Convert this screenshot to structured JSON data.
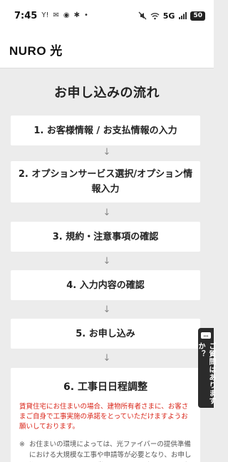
{
  "status_bar": {
    "time": "7:45",
    "left_glyphs": [
      "Y!",
      "✉",
      "◉",
      "✱",
      "•"
    ],
    "network": "5G",
    "battery": "50"
  },
  "header": {
    "logo": "NURO 光"
  },
  "page": {
    "title": "お申し込みの流れ",
    "arrow": "↓",
    "steps": [
      "1. お客様情報 / お支払情報の入力",
      "2. オプションサービス選択/オプション情報入力",
      "3. 規約・注意事項の確認",
      "4. 入力内容の確認",
      "5. お申し込み"
    ],
    "step6": {
      "title": "6. 工事日日程調整",
      "notice": "賃貸住宅にお住まいの場合、建物所有者さまに、お客さまご自身で工事実施の承諾をとっていただけますようお願いしております。",
      "note_mark": "※",
      "note": "お住まいの環境によっては、光ファイバーの提供準備における大規模な工事や申請等が必要となり、お申し込みから開通までに通常よりも更にお時間を要する場合や提供できない場合がございます。"
    }
  },
  "side_tab": {
    "icon": "…",
    "label": "ご質問はありますか？"
  }
}
